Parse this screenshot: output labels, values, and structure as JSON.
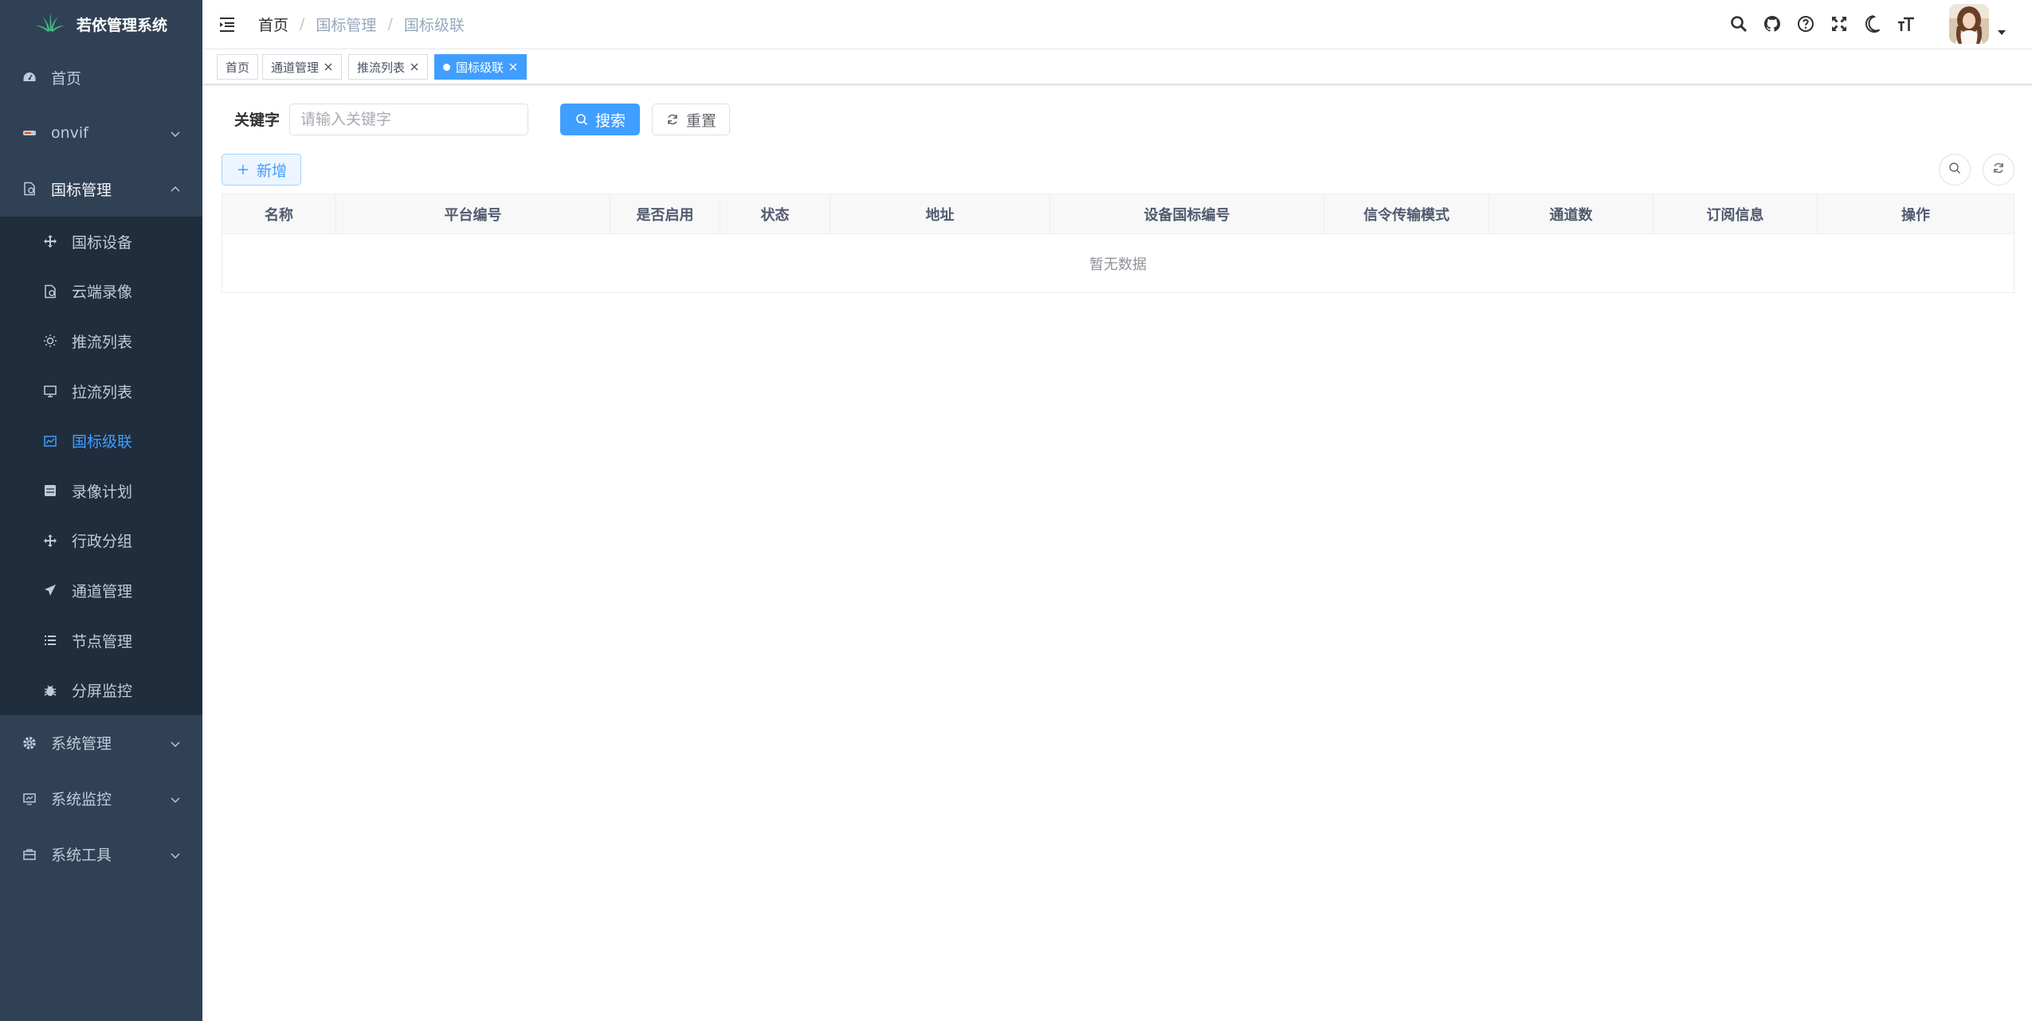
{
  "app": {
    "title": "若依管理系统"
  },
  "sidebar": {
    "items": [
      {
        "label": "首页",
        "icon": "dashboard-icon"
      },
      {
        "label": "onvif",
        "icon": "camera-icon"
      },
      {
        "label": "国标管理",
        "icon": "document-icon",
        "expanded": true,
        "children": [
          {
            "label": "国标设备",
            "icon": "move-icon"
          },
          {
            "label": "云端录像",
            "icon": "file-icon"
          },
          {
            "label": "推流列表",
            "icon": "sun-icon"
          },
          {
            "label": "拉流列表",
            "icon": "monitor-icon"
          },
          {
            "label": "国标级联",
            "icon": "chart-icon",
            "active": true
          },
          {
            "label": "录像计划",
            "icon": "server-icon"
          },
          {
            "label": "行政分组",
            "icon": "move-icon"
          },
          {
            "label": "通道管理",
            "icon": "send-icon"
          },
          {
            "label": "节点管理",
            "icon": "list-icon"
          },
          {
            "label": "分屏监控",
            "icon": "bug-icon"
          }
        ]
      },
      {
        "label": "系统管理",
        "icon": "gear-icon"
      },
      {
        "label": "系统监控",
        "icon": "monitor-icon"
      },
      {
        "label": "系统工具",
        "icon": "tool-icon"
      }
    ]
  },
  "breadcrumb": [
    "首页",
    "国标管理",
    "国标级联"
  ],
  "tags": [
    {
      "label": "首页",
      "closable": false
    },
    {
      "label": "通道管理",
      "closable": true
    },
    {
      "label": "推流列表",
      "closable": true
    },
    {
      "label": "国标级联",
      "closable": true,
      "active": true
    }
  ],
  "search": {
    "label": "关键字",
    "placeholder": "请输入关键字",
    "search_button": "搜索",
    "reset_button": "重置"
  },
  "toolbar": {
    "add_button": "新增"
  },
  "table": {
    "columns": [
      "名称",
      "平台编号",
      "是否启用",
      "状态",
      "地址",
      "设备国标编号",
      "信令传输模式",
      "通道数",
      "订阅信息",
      "操作"
    ],
    "rows": [],
    "empty_text": "暂无数据"
  },
  "colors": {
    "sidebar_bg": "#304156",
    "submenu_bg": "#1f2d3d",
    "primary": "#409eff"
  }
}
